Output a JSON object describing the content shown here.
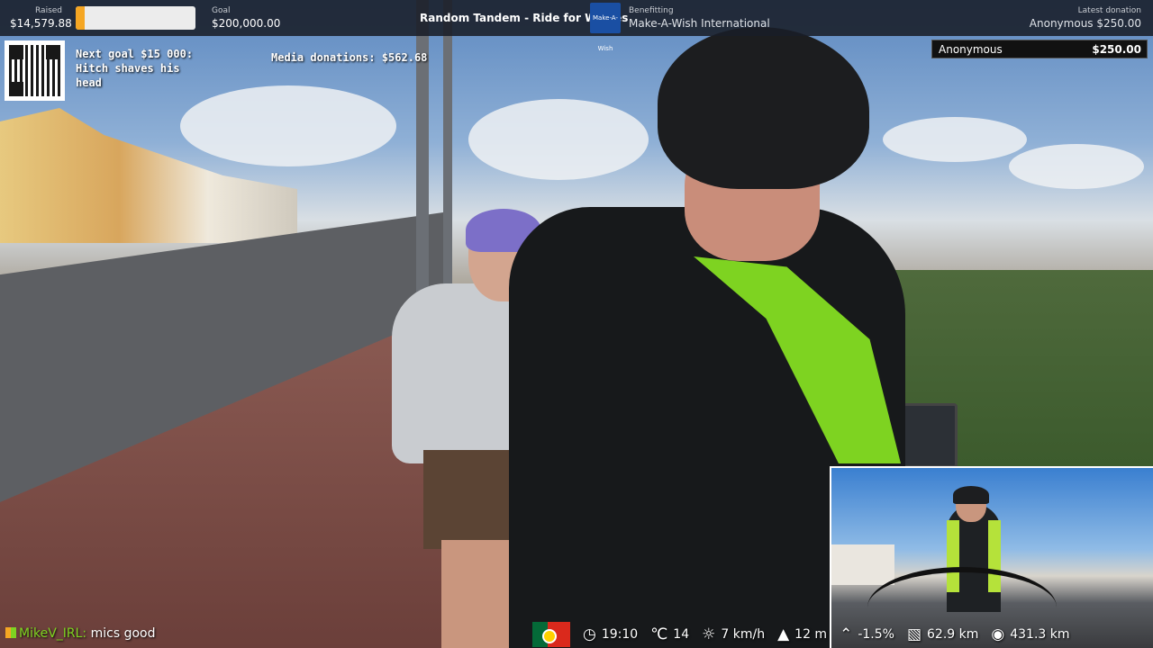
{
  "topbar": {
    "raised_label": "Raised",
    "raised_value": "$14,579.88",
    "raised_progress_fraction": 0.073,
    "goal_label": "Goal",
    "goal_value": "$200,000.00",
    "campaign_title": "Random Tandem - Ride for Wishes",
    "charity_logo_text": "Make-A-Wish",
    "benefitting_label": "Benefitting",
    "benefitting_value": "Make-A-Wish International",
    "latest_label": "Latest donation",
    "latest_value": "Anonymous $250.00"
  },
  "overlay": {
    "next_goal": "Next goal $15 000: Hitch shaves his head",
    "media_donations": "Media donations: $562.68",
    "donation_name": "Anonymous",
    "donation_amount": "$250.00"
  },
  "chat": {
    "user": "MikeV_IRL:",
    "message": "mics good"
  },
  "stats": {
    "flag": "portugal-flag",
    "time": "19:10",
    "temperature": "14",
    "speed": "7 km/h",
    "elevation": "12 m",
    "grade": "-1.5%",
    "distance_today": "62.9 km",
    "distance_total": "431.3 km"
  },
  "colors": {
    "progress": "#f5a623",
    "chat_user": "#7ed321",
    "topbar_bg": "#191e28"
  }
}
